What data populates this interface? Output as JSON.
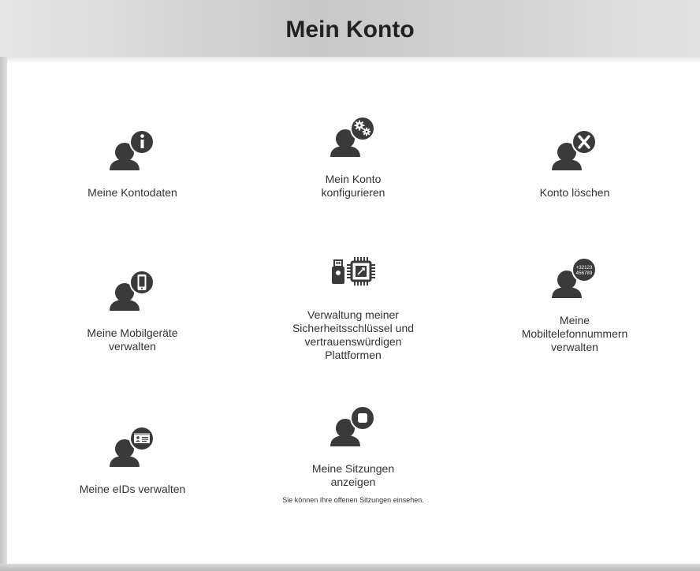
{
  "header": {
    "title": "Mein Konto"
  },
  "tiles": [
    {
      "title": "Meine Kontodaten",
      "icon": "user-info-icon"
    },
    {
      "title": "Mein Konto konfigurieren",
      "icon": "user-settings-icon"
    },
    {
      "title": "Konto löschen",
      "icon": "user-delete-icon"
    },
    {
      "title": "Meine Mobilgeräte verwalten",
      "icon": "user-mobile-icon"
    },
    {
      "title": "Verwaltung meiner Sicherheitsschlüssel und vertrauenswürdigen Plattformen",
      "icon": "security-key-chip-icon"
    },
    {
      "title": "Meine Mobiltelefonnummern verwalten",
      "icon": "user-phone-numbers-icon",
      "badge_line1": "+32123",
      "badge_line2": "456789"
    },
    {
      "title": "Meine eIDs verwalten",
      "icon": "user-id-card-icon"
    },
    {
      "title": "Meine Sitzungen anzeigen",
      "subtitle": "Sie können Ihre offenen Sitzungen einsehen.",
      "icon": "user-session-icon"
    }
  ]
}
